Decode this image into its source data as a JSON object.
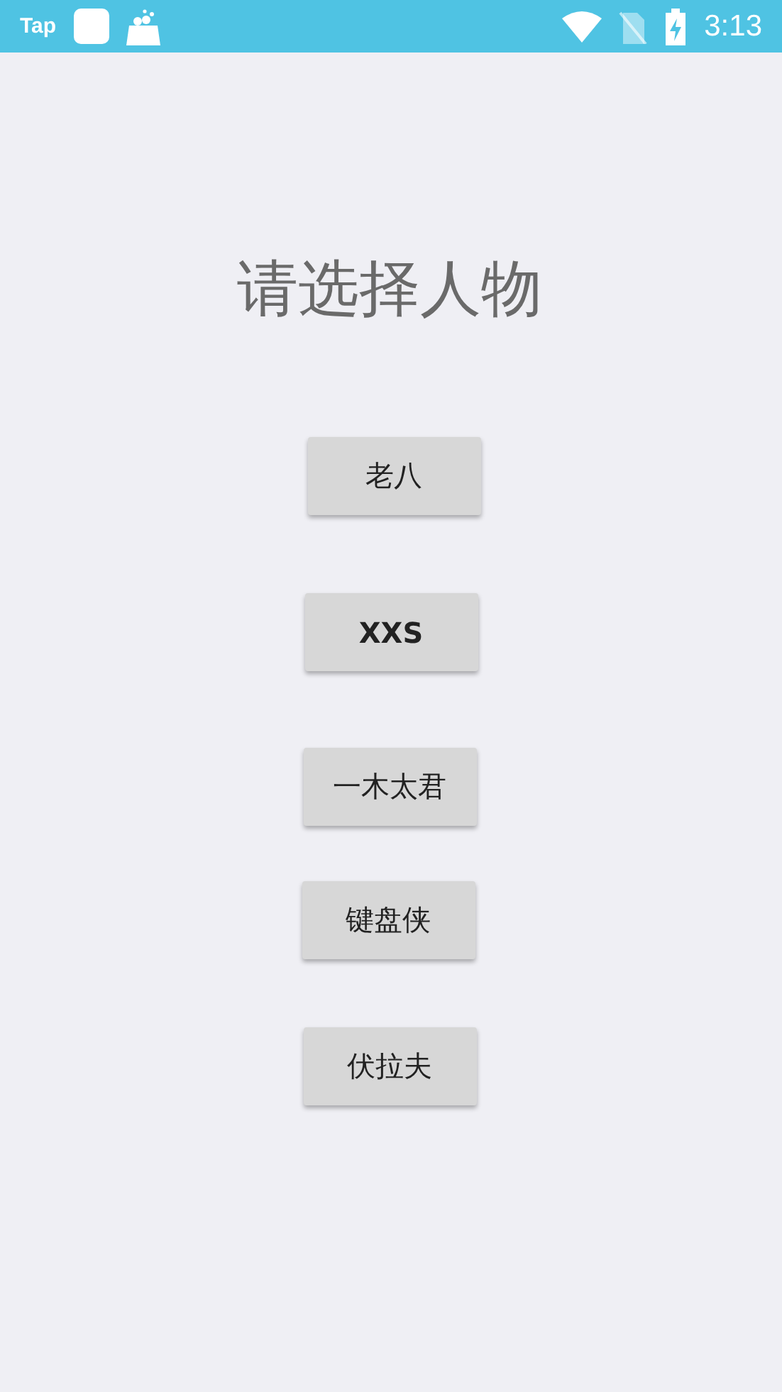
{
  "status_bar": {
    "app_label": "Tap",
    "time": "3:13"
  },
  "title": "请选择人物",
  "buttons": [
    {
      "label": "老八"
    },
    {
      "label": "XXS",
      "kind": "bold"
    },
    {
      "label": "一木太君"
    },
    {
      "label": "键盘侠"
    },
    {
      "label": "伏拉夫"
    }
  ]
}
